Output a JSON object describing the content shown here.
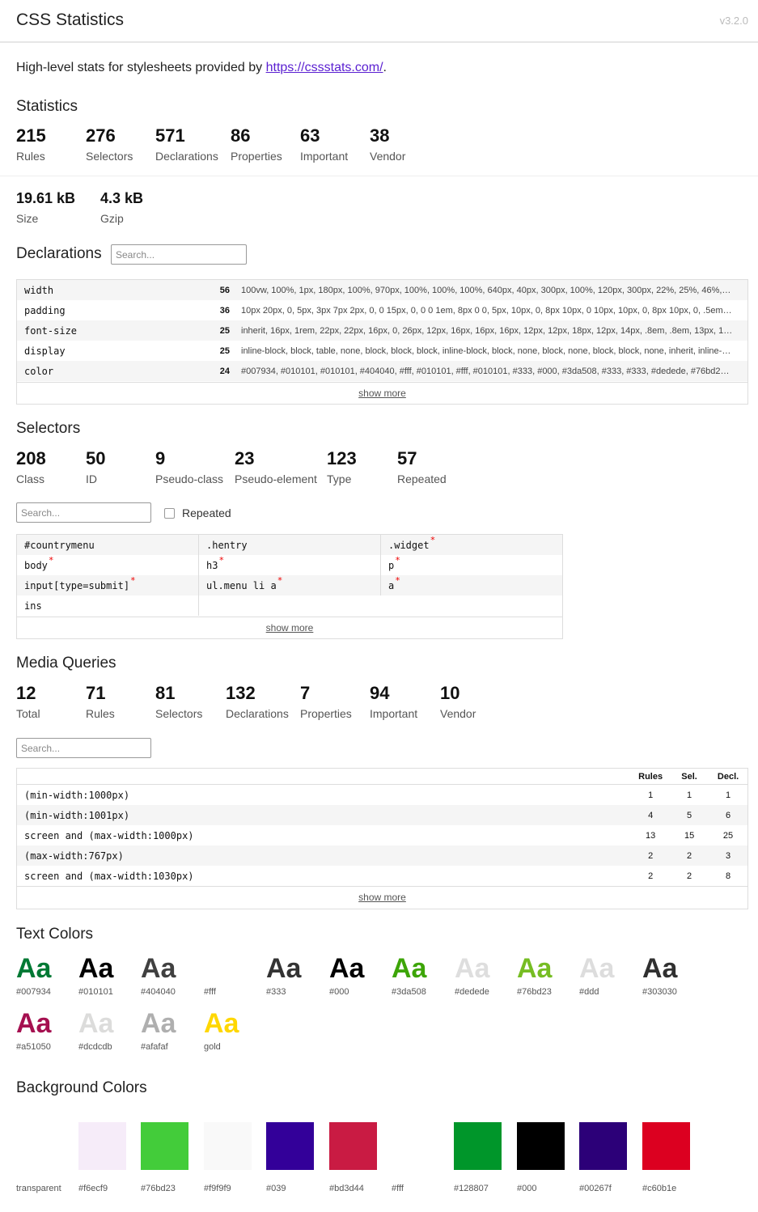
{
  "header": {
    "title": "CSS Statistics",
    "version": "v3.2.0"
  },
  "intro": {
    "text": "High-level stats for stylesheets provided by ",
    "link": "https://cssstats.com/",
    "suffix": "."
  },
  "statistics": {
    "title": "Statistics",
    "items": [
      {
        "value": "215",
        "label": "Rules"
      },
      {
        "value": "276",
        "label": "Selectors"
      },
      {
        "value": "571",
        "label": "Declarations"
      },
      {
        "value": "86",
        "label": "Properties"
      },
      {
        "value": "63",
        "label": "Important"
      },
      {
        "value": "38",
        "label": "Vendor"
      }
    ],
    "size": [
      {
        "value": "19.61 kB",
        "label": "Size"
      },
      {
        "value": "4.3 kB",
        "label": "Gzip"
      }
    ]
  },
  "declarations": {
    "title": "Declarations",
    "search_placeholder": "Search...",
    "rows": [
      {
        "property": "width",
        "count": "56",
        "values": "100vw, 100%, 1px, 180px, 100%, 970px, 100%, 100%, 100%, 640px, 40px, 300px, 100%, 120px, 300px, 22%, 25%, 46%, 19%, 60%, 40p..."
      },
      {
        "property": "padding",
        "count": "36",
        "values": "10px 20px, 0, 5px, 3px 7px 2px, 0, 0 15px, 0, 0 0 1em, 8px 0 0, 5px, 10px, 0, 8px 10px, 0 10px, 10px, 0, 8px 10px, 0, .5em 0 5px, .4e..."
      },
      {
        "property": "font-size",
        "count": "25",
        "values": "inherit, 16px, 1rem, 22px, 22px, 16px, 0, 26px, 12px, 16px, 16px, 16px, 12px, 12px, 18px, 12px, 14px, .8em, .8em, 13px, 12px, 11px, ..."
      },
      {
        "property": "display",
        "count": "25",
        "values": "inline-block, block, table, none, block, block, block, inline-block, block, none, block, none, block, block, none, inherit, inline-bloc..."
      },
      {
        "property": "color",
        "count": "24",
        "values": "#007934, #010101, #010101, #404040, #fff, #010101, #fff, #010101, #333, #000, #3da508, #333, #333, #dedede, #76bd23, #d..."
      }
    ],
    "show_more": "show more"
  },
  "selectors": {
    "title": "Selectors",
    "items": [
      {
        "value": "208",
        "label": "Class"
      },
      {
        "value": "50",
        "label": "ID"
      },
      {
        "value": "9",
        "label": "Pseudo-class"
      },
      {
        "value": "23",
        "label": "Pseudo-element"
      },
      {
        "value": "123",
        "label": "Type"
      },
      {
        "value": "57",
        "label": "Repeated"
      }
    ],
    "search_placeholder": "Search...",
    "repeated_label": "Repeated",
    "repeated_checked": false,
    "grid": [
      {
        "text": "#countrymenu",
        "repeated": false
      },
      {
        "text": ".hentry",
        "repeated": false
      },
      {
        "text": ".widget",
        "repeated": true
      },
      {
        "text": "body",
        "repeated": true
      },
      {
        "text": "h3",
        "repeated": true
      },
      {
        "text": "p",
        "repeated": true
      },
      {
        "text": "input[type=submit]",
        "repeated": true
      },
      {
        "text": "ul.menu li a",
        "repeated": true
      },
      {
        "text": "a",
        "repeated": true
      },
      {
        "text": "ins",
        "repeated": false
      }
    ],
    "star": "*",
    "show_more": "show more"
  },
  "media_queries": {
    "title": "Media Queries",
    "items": [
      {
        "value": "12",
        "label": "Total"
      },
      {
        "value": "71",
        "label": "Rules"
      },
      {
        "value": "81",
        "label": "Selectors"
      },
      {
        "value": "132",
        "label": "Declarations"
      },
      {
        "value": "7",
        "label": "Properties"
      },
      {
        "value": "94",
        "label": "Important"
      },
      {
        "value": "10",
        "label": "Vendor"
      }
    ],
    "search_placeholder": "Search...",
    "columns": [
      "Rules",
      "Sel.",
      "Decl."
    ],
    "rows": [
      {
        "query": "(min-width:1000px)",
        "rules": "1",
        "sel": "1",
        "decl": "1"
      },
      {
        "query": "(min-width:1001px)",
        "rules": "4",
        "sel": "5",
        "decl": "6"
      },
      {
        "query": "screen and (max-width:1000px)",
        "rules": "13",
        "sel": "15",
        "decl": "25"
      },
      {
        "query": "(max-width:767px)",
        "rules": "2",
        "sel": "2",
        "decl": "3"
      },
      {
        "query": "screen and (max-width:1030px)",
        "rules": "2",
        "sel": "2",
        "decl": "8"
      }
    ],
    "show_more": "show more"
  },
  "text_colors": {
    "title": "Text Colors",
    "sample": "Aa",
    "items": [
      {
        "label": "#007934",
        "color": "#007934"
      },
      {
        "label": "#010101",
        "color": "#010101"
      },
      {
        "label": "#404040",
        "color": "#404040"
      },
      {
        "label": "#fff",
        "color": "#ffffff"
      },
      {
        "label": "#333",
        "color": "#333333"
      },
      {
        "label": "#000",
        "color": "#000000"
      },
      {
        "label": "#3da508",
        "color": "#3da508"
      },
      {
        "label": "#dedede",
        "color": "#dedede"
      },
      {
        "label": "#76bd23",
        "color": "#76bd23"
      },
      {
        "label": "#ddd",
        "color": "#dddddd"
      },
      {
        "label": "#303030",
        "color": "#303030"
      },
      {
        "label": "#a51050",
        "color": "#a51050"
      },
      {
        "label": "#dcdcdb",
        "color": "#dcdcdb"
      },
      {
        "label": "#afafaf",
        "color": "#afafaf"
      },
      {
        "label": "gold",
        "color": "#ffd700"
      }
    ]
  },
  "background_colors": {
    "title": "Background Colors",
    "items": [
      {
        "label": "transparent",
        "color": "transparent"
      },
      {
        "label": "#f6ecf9",
        "color": "#f6ecf9"
      },
      {
        "label": "#76bd23",
        "color": "#43cc3a"
      },
      {
        "label": "#f9f9f9",
        "color": "#f9f9f9"
      },
      {
        "label": "#039",
        "color": "#330099"
      },
      {
        "label": "#bd3d44",
        "color": "#c91b43"
      },
      {
        "label": "#fff",
        "color": "#ffffff"
      },
      {
        "label": "#128807",
        "color": "#00962a"
      },
      {
        "label": "#000",
        "color": "#000000"
      },
      {
        "label": "#00267f",
        "color": "#2c0078"
      },
      {
        "label": "#c60b1e",
        "color": "#dc0020"
      }
    ]
  }
}
